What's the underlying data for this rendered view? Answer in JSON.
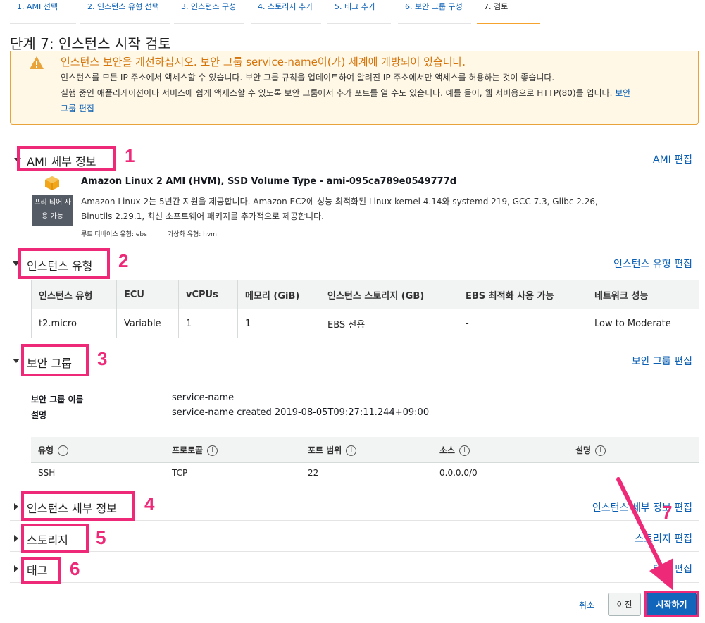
{
  "wizard_tabs": [
    "1. AMI 선택",
    "2. 인스턴스 유형 선택",
    "3. 인스턴스 구성",
    "4. 스토리지 추가",
    "5. 태그 추가",
    "6. 보안 그룹 구성",
    "7. 검토"
  ],
  "page_title": "단계 7: 인스턴스 시작 검토",
  "warning": {
    "title": "인스턴스 보안을 개선하십시오. 보안 그룹 service-name이(가) 세계에 개방되어 있습니다.",
    "line1": "인스턴스를 모든 IP 주소에서 액세스할 수 있습니다. 보안 그룹 규칙을 업데이트하여 알려진 IP 주소에서만 액세스를 허용하는 것이 좋습니다.",
    "line2": "실행 중인 애플리케이션이나 서비스에 쉽게 액세스할 수 있도록 보안 그룹에서 추가 포트를 열 수도 있습니다. 예를 들어, 웹 서버용으로 HTTP(80)를 엽니다.",
    "link_part1": "보안",
    "link_part2": "그룹 편집"
  },
  "ami": {
    "section_title": "AMI 세부 정보",
    "edit_link": "AMI 편집",
    "name": "Amazon Linux 2 AMI (HVM), SSD Volume Type - ami-095ca789e0549777d",
    "desc1": "Amazon Linux 2는 5년간 지원을 제공합니다. Amazon EC2에 성능 최적화된 Linux kernel 4.14와 systemd 219, GCC 7.3, Glibc 2.26,",
    "desc2": "Binutils 2.29.1, 최신 소프트웨어 패키지를 추가적으로 제공합니다.",
    "root_device": "루트 디바이스 유형: ebs",
    "virtualization": "가상화 유형: hvm",
    "free_tier_line1": "프리 티어 사",
    "free_tier_line2": "용 가능"
  },
  "instance_type": {
    "section_title": "인스턴스 유형",
    "edit_link": "인스턴스 유형 편집",
    "headers": [
      "인스턴스 유형",
      "ECU",
      "vCPUs",
      "메모리 (GiB)",
      "인스턴스 스토리지 (GB)",
      "EBS 최적화 사용 가능",
      "네트워크 성능"
    ],
    "row": [
      "t2.micro",
      "Variable",
      "1",
      "1",
      "EBS 전용",
      "-",
      "Low to Moderate"
    ]
  },
  "security_group": {
    "section_title": "보안 그룹",
    "edit_link": "보안 그룹 편집",
    "name_label": "보안 그룹 이름",
    "name_value": "service-name",
    "desc_label": "설명",
    "desc_value": "service-name created 2019-08-05T09:27:11.244+09:00",
    "headers": [
      "유형",
      "프로토콜",
      "포트 범위",
      "소스",
      "설명"
    ],
    "row": [
      "SSH",
      "TCP",
      "22",
      "0.0.0.0/0",
      ""
    ]
  },
  "instance_details": {
    "section_title": "인스턴스 세부 정보",
    "edit_link": "인스턴스 세부 정보 편집"
  },
  "storage": {
    "section_title": "스토리지",
    "edit_link": "스토리지 편집"
  },
  "tags": {
    "section_title": "태그",
    "edit_link": "태그 편집"
  },
  "annotations": [
    "1",
    "2",
    "3",
    "4",
    "5",
    "6",
    "7"
  ],
  "buttons": {
    "cancel": "취소",
    "previous": "이전",
    "launch": "시작하기"
  },
  "colors": {
    "annotation": "#ee2a78",
    "link": "#0a5fb4",
    "warning": "#d4740a",
    "primary": "#1166bb"
  }
}
